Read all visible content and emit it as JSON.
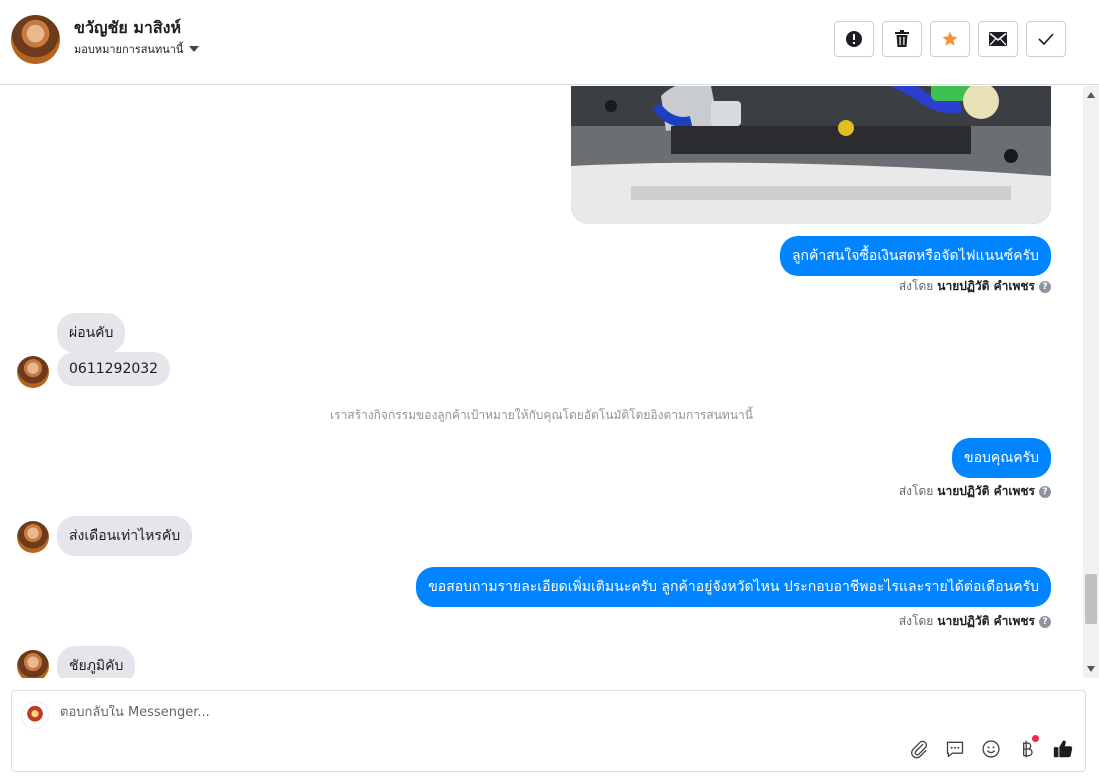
{
  "header": {
    "user_name": "ขวัญชัย มาสิงห์",
    "assign_label": "มอบหมายการสนทนานี้",
    "actions": [
      {
        "name": "mark-spam-button",
        "icon": "exclamation-icon"
      },
      {
        "name": "delete-button",
        "icon": "trash-icon"
      },
      {
        "name": "star-button",
        "icon": "star-icon",
        "color": "#f7923a"
      },
      {
        "name": "mark-unread-button",
        "icon": "envelope-icon"
      },
      {
        "name": "mark-done-button",
        "icon": "check-icon"
      }
    ]
  },
  "thread": {
    "messages": [
      {
        "dir": "out",
        "text": "ลูกค้าสนใจซื้อเงินสดหรือจัดไฟแนนซ์ครับ"
      },
      {
        "dir": "in",
        "text": "ผ่อนคับ"
      },
      {
        "dir": "in",
        "text": "0611292032"
      },
      {
        "dir": "out",
        "text": "ขอบคุณครับ"
      },
      {
        "dir": "in",
        "text": "ส่งเดือนเท่าไหรคับ"
      },
      {
        "dir": "out",
        "text": "ขอสอบถามรายละเอียดเพิ่มเติมนะครับ ลูกค้าอยู่จังหวัดไหน ประกอบอาชีพอะไรและรายได้ต่อเดือนครับ"
      },
      {
        "dir": "in",
        "text": "ชัยภูมิคับ"
      }
    ],
    "sent_by_prefix": "ส่งโดย",
    "sent_by_name": "นายปฏิวัติ คำเพชร",
    "system_note": "เราสร้างกิจกรรมของลูกค้าเป้าหมายให้กับคุณโดยอัตโนมัติโดยอิงตามการสนทนานี้"
  },
  "composer": {
    "placeholder": "ตอบกลับใน Messenger..."
  },
  "colors": {
    "outgoing_bubble": "#0084ff",
    "incoming_bubble": "#e4e6eb",
    "star": "#f7923a"
  }
}
